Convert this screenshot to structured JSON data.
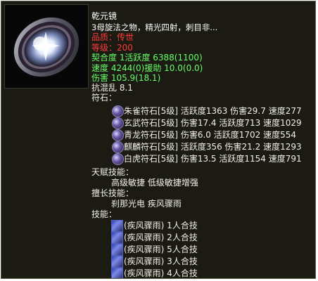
{
  "item": {
    "name": "乾元镜",
    "description": "3母旋法之物，精光四射，刺目非..."
  },
  "attributes": {
    "quality": "品质：传世",
    "level": "等级：200",
    "line1": "契合度     1活跃度   6388(1100)",
    "line2": "速度      4244(0)援助      10.0(0.0)",
    "line3": "伤害    105.9(18.1)",
    "line4": "抗混乱  8.1"
  },
  "runes": {
    "header": "符石：",
    "items": [
      "朱雀符石[5级] 活跃度1363 伤害29.7 速度277",
      "玄武符石[5级] 伤害17.4 活跃度713 速度1029",
      "青龙符石[5级] 伤害6.0 活跃度1702 速度554",
      "麒麟符石[5级] 活跃度356 伤害21.2 速度1293",
      "白虎符石[5级] 伤害13.5 活跃度1154 速度791"
    ]
  },
  "talents": {
    "header": "天赋技能：",
    "row": "高级敏捷     低级敏捷增强"
  },
  "specialty": {
    "header": "擅长技能：",
    "row": "刹那光电     疾风骤雨"
  },
  "skills": {
    "header": "技能：",
    "items": [
      "(疾风骤雨) 1人合技",
      "(疾风骤雨) 2人合技",
      "(疾风骤雨) 5人合技",
      "(疾风骤雨) 3人合技",
      "(疾风骤雨) 4人合技"
    ]
  },
  "icons": {
    "portrait": "mirror-artifact-icon",
    "rune": "rune-stone-icon",
    "skill": "skill-scroll-icon"
  }
}
